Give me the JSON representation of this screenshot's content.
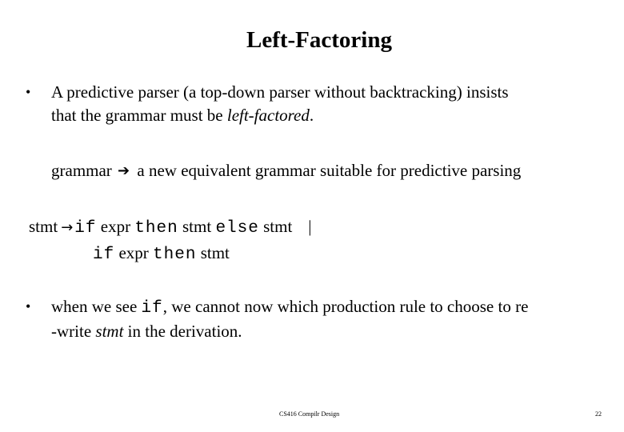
{
  "slide": {
    "title": "Left-Factoring",
    "bullet1": {
      "marker": "•",
      "line1": "A predictive parser (a top-down parser without backtracking) insists",
      "line2_prefix": "that the grammar must be ",
      "line2_italic": "left-factored",
      "line2_suffix": "."
    },
    "transform": {
      "left": "grammar",
      "arrow_icon": "➔",
      "right": "a new equivalent grammar suitable for predictive parsing"
    },
    "grammar": {
      "lhs": "stmt",
      "arrow": "→",
      "rule1": {
        "kw_if": "if",
        "expr": "expr",
        "kw_then": "then",
        "stmt1": "stmt",
        "kw_else": "else",
        "stmt2": "stmt",
        "separator": "|"
      },
      "rule2": {
        "kw_if": "if",
        "expr": "expr",
        "kw_then": "then",
        "stmt": "stmt"
      }
    },
    "bullet2": {
      "marker": "•",
      "line1_prefix": "when we see ",
      "line1_code": "if",
      "line1_suffix": ", we cannot now which production rule to choose to  re",
      "line2_prefix": "-write ",
      "line2_italic": "stmt",
      "line2_suffix": " in the derivation."
    },
    "footer": {
      "course": "CS416 Compilr Design",
      "page_number": "22"
    }
  }
}
